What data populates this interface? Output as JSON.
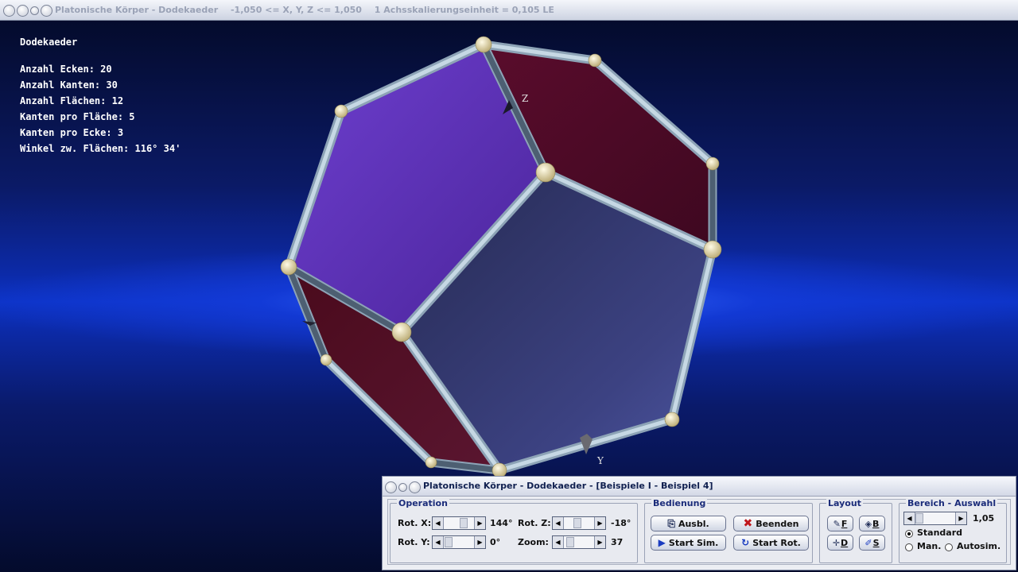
{
  "window": {
    "title": "Platonische Körper - Dodekaeder",
    "range_text": "-1,050 <= X, Y, Z <= 1,050",
    "scale_text": "1 Achsskalierungseinheit = 0,105 LE"
  },
  "info": {
    "heading": "Dodekaeder",
    "rows": [
      "Anzahl Ecken: 20",
      "Anzahl Kanten: 30",
      "Anzahl Flächen: 12",
      "Kanten pro Fläche: 5",
      "Kanten pro Ecke: 3",
      "Winkel zw. Flächen: 116° 34'"
    ]
  },
  "scene": {
    "axis_z_label": "Z",
    "axis_y_label": "Y",
    "colors": {
      "violet_face": "#5b2fb0",
      "slate_face": "#2f3468",
      "maroon_face": "#4a0a24",
      "edge": "#a8bccc",
      "vertex": "#e8dcaa"
    }
  },
  "dialog": {
    "title": "Platonische Körper - Dodekaeder - [Beispiele I - Beispiel 4]",
    "operation": {
      "title": "Operation",
      "rot_x_label": "Rot. X:",
      "rot_x_value": "144°",
      "rot_y_label": "Rot. Y:",
      "rot_y_value": "0°",
      "rot_z_label": "Rot. Z:",
      "rot_z_value": "-18°",
      "zoom_label": "Zoom:",
      "zoom_value": "37"
    },
    "bedienung": {
      "title": "Bedienung",
      "ausbl": "Ausbl.",
      "beenden": "Beenden",
      "start_sim": "Start Sim.",
      "start_rot": "Start Rot."
    },
    "layout": {
      "title": "Layout",
      "f": "F",
      "b": "B",
      "d": "D",
      "s": "S"
    },
    "bereich": {
      "title": "Bereich - Auswahl",
      "value": "1,05",
      "standard": "Standard",
      "man": "Man.",
      "autosim": "Autosim.",
      "selected": "Standard"
    }
  }
}
